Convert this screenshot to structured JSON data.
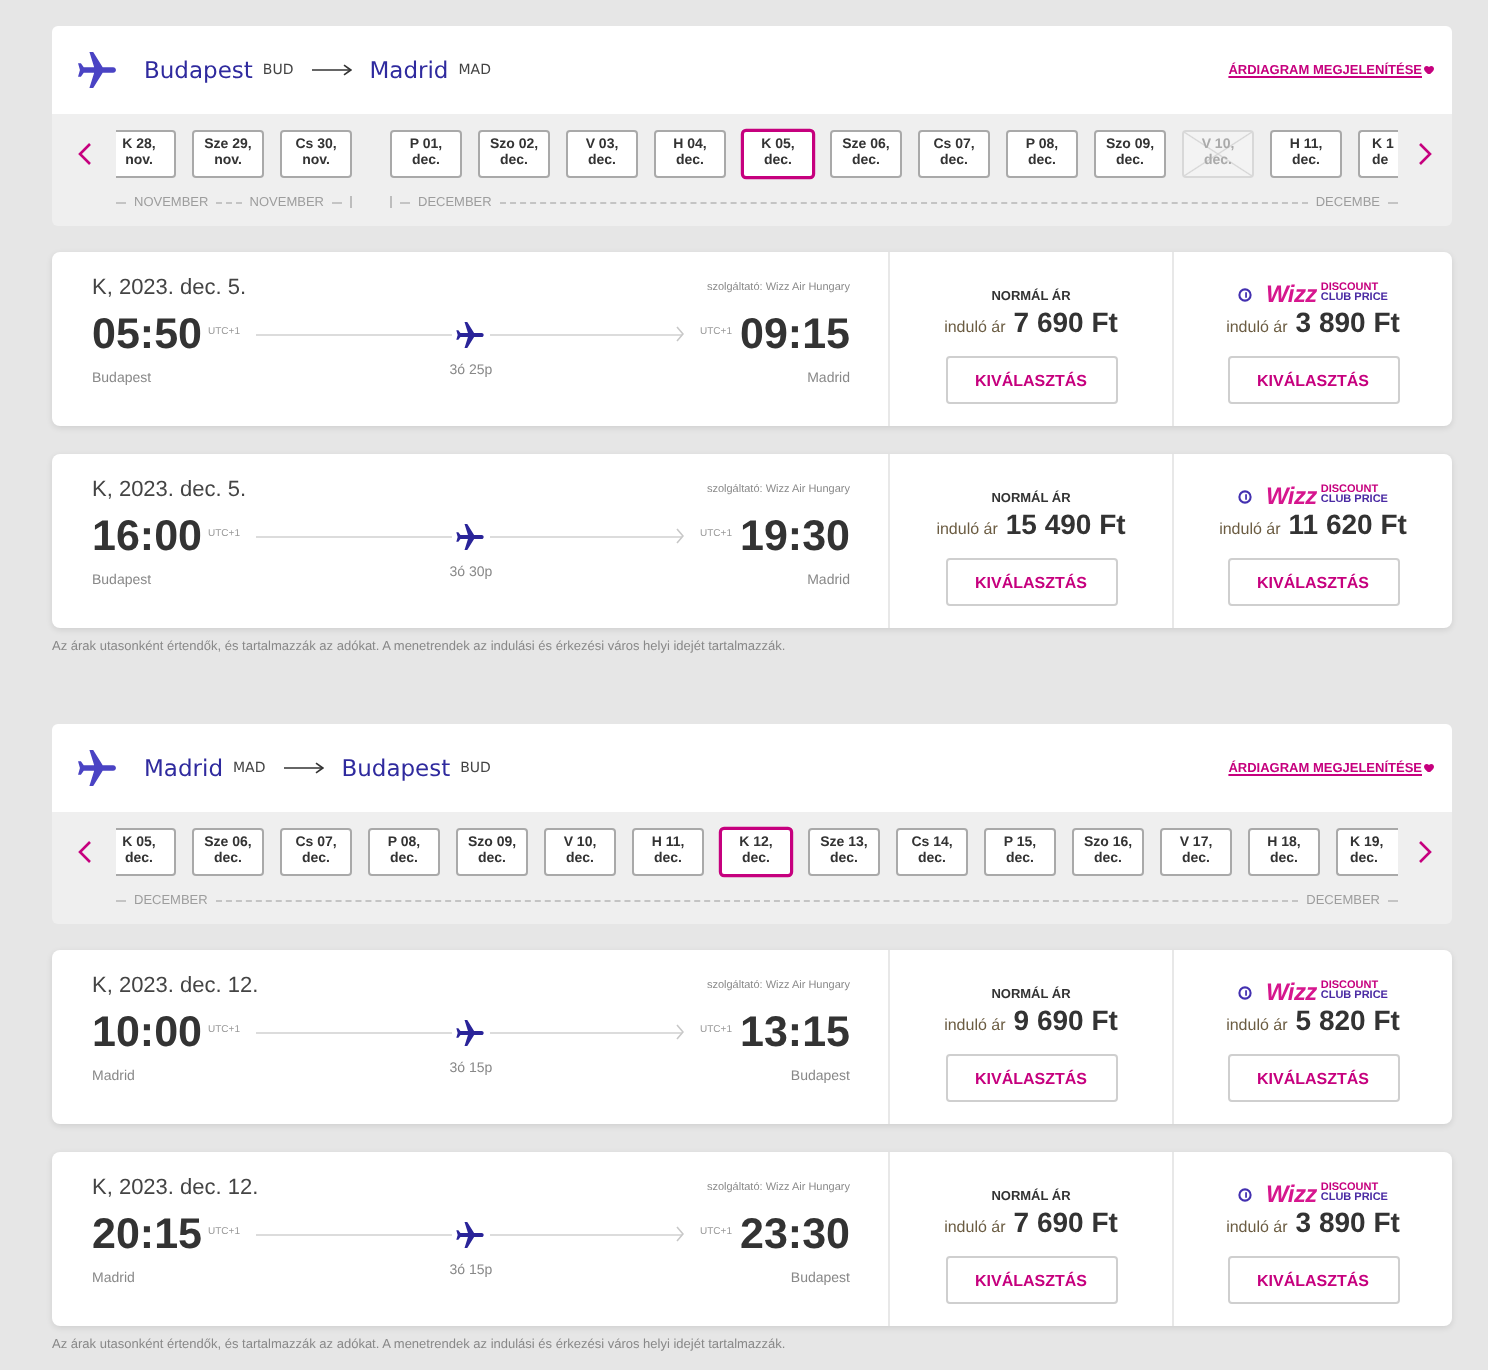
{
  "sections": [
    {
      "route": {
        "origin": {
          "city": "Budapest",
          "code": "BUD"
        },
        "destination": {
          "city": "Madrid",
          "code": "MAD"
        }
      },
      "price_chart_link": "ÁRDIAGRAM MEGJELENÍTÉSE",
      "date_strip": {
        "groups": [
          {
            "month_start": "NOVEMBER",
            "month_end": "NOVEMBER",
            "dates": [
              {
                "day": "K 28,",
                "month": "nov.",
                "selected": false,
                "disabled": false
              },
              {
                "day": "Sze 29,",
                "month": "nov.",
                "selected": false,
                "disabled": false
              },
              {
                "day": "Cs 30,",
                "month": "nov.",
                "selected": false,
                "disabled": false
              }
            ]
          },
          {
            "month_start": "DECEMBER",
            "month_end": "DECEMBE",
            "dates": [
              {
                "day": "P 01,",
                "month": "dec.",
                "selected": false,
                "disabled": false
              },
              {
                "day": "Szo 02,",
                "month": "dec.",
                "selected": false,
                "disabled": false
              },
              {
                "day": "V 03,",
                "month": "dec.",
                "selected": false,
                "disabled": false
              },
              {
                "day": "H 04,",
                "month": "dec.",
                "selected": false,
                "disabled": false
              },
              {
                "day": "K 05,",
                "month": "dec.",
                "selected": true,
                "disabled": false
              },
              {
                "day": "Sze 06,",
                "month": "dec.",
                "selected": false,
                "disabled": false
              },
              {
                "day": "Cs 07,",
                "month": "dec.",
                "selected": false,
                "disabled": false
              },
              {
                "day": "P 08,",
                "month": "dec.",
                "selected": false,
                "disabled": false
              },
              {
                "day": "Szo 09,",
                "month": "dec.",
                "selected": false,
                "disabled": false
              },
              {
                "day": "V 10,",
                "month": "dec.",
                "selected": false,
                "disabled": true
              },
              {
                "day": "H 11,",
                "month": "dec.",
                "selected": false,
                "disabled": false
              },
              {
                "day": "K 1",
                "month": "de",
                "selected": false,
                "disabled": false
              }
            ]
          }
        ]
      },
      "flights": [
        {
          "date": "K, 2023. dec. 5.",
          "operator": "szolgáltató: Wizz Air Hungary",
          "departure": {
            "time": "05:50",
            "timezone": "UTC+1",
            "city": "Budapest"
          },
          "duration": "3ó 25p",
          "arrival": {
            "time": "09:15",
            "timezone": "UTC+1",
            "city": "Madrid"
          },
          "fares": [
            {
              "kind": "normal",
              "title": "NORMÁL ÁR",
              "from_label": "induló ár",
              "price": "7 690 Ft",
              "button": "KIVÁLASZTÁS"
            },
            {
              "kind": "club",
              "logo": {
                "brand": "Wizz",
                "line_1": "DISCOUNT",
                "line_2": "CLUB PRICE"
              },
              "from_label": "induló ár",
              "price": "3 890 Ft",
              "button": "KIVÁLASZTÁS"
            }
          ]
        },
        {
          "date": "K, 2023. dec. 5.",
          "operator": "szolgáltató: Wizz Air Hungary",
          "departure": {
            "time": "16:00",
            "timezone": "UTC+1",
            "city": "Budapest"
          },
          "duration": "3ó 30p",
          "arrival": {
            "time": "19:30",
            "timezone": "UTC+1",
            "city": "Madrid"
          },
          "fares": [
            {
              "kind": "normal",
              "title": "NORMÁL ÁR",
              "from_label": "induló ár",
              "price": "15 490 Ft",
              "button": "KIVÁLASZTÁS"
            },
            {
              "kind": "club",
              "logo": {
                "brand": "Wizz",
                "line_1": "DISCOUNT",
                "line_2": "CLUB PRICE"
              },
              "from_label": "induló ár",
              "price": "11 620 Ft",
              "button": "KIVÁLASZTÁS"
            }
          ]
        }
      ],
      "footnote": "Az árak utasonként értendők, és tartalmazzák az adókat. A menetrendek az indulási és érkezési város helyi idejét tartalmazzák."
    },
    {
      "route": {
        "origin": {
          "city": "Madrid",
          "code": "MAD"
        },
        "destination": {
          "city": "Budapest",
          "code": "BUD"
        }
      },
      "price_chart_link": "ÁRDIAGRAM MEGJELENÍTÉSE",
      "date_strip": {
        "groups": [
          {
            "month_start": "DECEMBER",
            "month_end": "DECEMBER",
            "dates": [
              {
                "day": "K 05,",
                "month": "dec.",
                "selected": false,
                "disabled": false
              },
              {
                "day": "Sze 06,",
                "month": "dec.",
                "selected": false,
                "disabled": false
              },
              {
                "day": "Cs 07,",
                "month": "dec.",
                "selected": false,
                "disabled": false
              },
              {
                "day": "P 08,",
                "month": "dec.",
                "selected": false,
                "disabled": false
              },
              {
                "day": "Szo 09,",
                "month": "dec.",
                "selected": false,
                "disabled": false
              },
              {
                "day": "V 10,",
                "month": "dec.",
                "selected": false,
                "disabled": false
              },
              {
                "day": "H 11,",
                "month": "dec.",
                "selected": false,
                "disabled": false
              },
              {
                "day": "K 12,",
                "month": "dec.",
                "selected": true,
                "disabled": false
              },
              {
                "day": "Sze 13,",
                "month": "dec.",
                "selected": false,
                "disabled": false
              },
              {
                "day": "Cs 14,",
                "month": "dec.",
                "selected": false,
                "disabled": false
              },
              {
                "day": "P 15,",
                "month": "dec.",
                "selected": false,
                "disabled": false
              },
              {
                "day": "Szo 16,",
                "month": "dec.",
                "selected": false,
                "disabled": false
              },
              {
                "day": "V 17,",
                "month": "dec.",
                "selected": false,
                "disabled": false
              },
              {
                "day": "H 18,",
                "month": "dec.",
                "selected": false,
                "disabled": false
              },
              {
                "day": "K 19,",
                "month": "dec.",
                "selected": false,
                "disabled": false
              }
            ]
          }
        ]
      },
      "flights": [
        {
          "date": "K, 2023. dec. 12.",
          "operator": "szolgáltató: Wizz Air Hungary",
          "departure": {
            "time": "10:00",
            "timezone": "UTC+1",
            "city": "Madrid"
          },
          "duration": "3ó 15p",
          "arrival": {
            "time": "13:15",
            "timezone": "UTC+1",
            "city": "Budapest"
          },
          "fares": [
            {
              "kind": "normal",
              "title": "NORMÁL ÁR",
              "from_label": "induló ár",
              "price": "9 690 Ft",
              "button": "KIVÁLASZTÁS"
            },
            {
              "kind": "club",
              "logo": {
                "brand": "Wizz",
                "line_1": "DISCOUNT",
                "line_2": "CLUB PRICE"
              },
              "from_label": "induló ár",
              "price": "5 820 Ft",
              "button": "KIVÁLASZTÁS"
            }
          ]
        },
        {
          "date": "K, 2023. dec. 12.",
          "operator": "szolgáltató: Wizz Air Hungary",
          "departure": {
            "time": "20:15",
            "timezone": "UTC+1",
            "city": "Madrid"
          },
          "duration": "3ó 15p",
          "arrival": {
            "time": "23:30",
            "timezone": "UTC+1",
            "city": "Budapest"
          },
          "fares": [
            {
              "kind": "normal",
              "title": "NORMÁL ÁR",
              "from_label": "induló ár",
              "price": "7 690 Ft",
              "button": "KIVÁLASZTÁS"
            },
            {
              "kind": "club",
              "logo": {
                "brand": "Wizz",
                "line_1": "DISCOUNT",
                "line_2": "CLUB PRICE"
              },
              "from_label": "induló ár",
              "price": "3 890 Ft",
              "button": "KIVÁLASZTÁS"
            }
          ]
        }
      ],
      "footnote": "Az árak utasonként értendők, és tartalmazzák az adókat. A menetrendek az indulási és érkezési város helyi idejét tartalmazzák."
    }
  ]
}
